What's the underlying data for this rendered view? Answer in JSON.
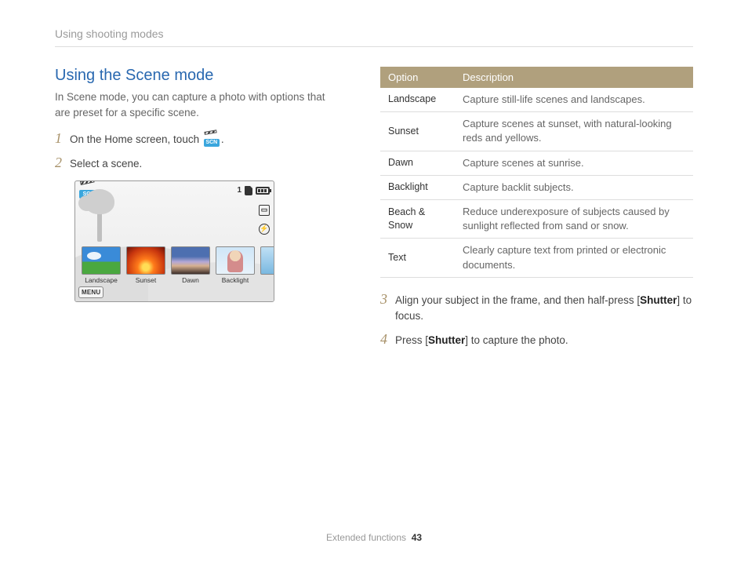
{
  "breadcrumb": "Using shooting modes",
  "heading": "Using the Scene mode",
  "intro": "In Scene mode, you can capture a photo with options that are preset for a specific scene.",
  "steps": {
    "s1": {
      "num": "1",
      "text_a": "On the Home screen, touch ",
      "text_b": "."
    },
    "s2": {
      "num": "2",
      "text": "Select a scene."
    },
    "s3": {
      "num": "3",
      "text_a": "Align your subject in the frame, and then half-press [",
      "bold": "Shutter",
      "text_b": "] to focus."
    },
    "s4": {
      "num": "4",
      "text_a": "Press [",
      "bold": "Shutter",
      "text_b": "] to capture the photo."
    }
  },
  "display": {
    "scn_label": "SCN",
    "counter": "1",
    "menu": "MENU",
    "thumbs": [
      {
        "label": "Landscape",
        "cls": "landscape"
      },
      {
        "label": "Sunset",
        "cls": "sunset"
      },
      {
        "label": "Dawn",
        "cls": "dawn"
      },
      {
        "label": "Backlight",
        "cls": "backlight"
      }
    ]
  },
  "table": {
    "headers": {
      "option": "Option",
      "description": "Description"
    },
    "rows": [
      {
        "option": "Landscape",
        "desc": "Capture still-life scenes and landscapes."
      },
      {
        "option": "Sunset",
        "desc": "Capture scenes at sunset, with natural-looking reds and yellows."
      },
      {
        "option": "Dawn",
        "desc": "Capture scenes at sunrise."
      },
      {
        "option": "Backlight",
        "desc": "Capture backlit subjects."
      },
      {
        "option": "Beach & Snow",
        "desc": "Reduce underexposure of subjects caused by sunlight reflected from sand or snow."
      },
      {
        "option": "Text",
        "desc": "Clearly capture text from printed or electronic documents."
      }
    ]
  },
  "footer": {
    "section": "Extended functions",
    "page": "43"
  },
  "inline_scn": "SCN"
}
